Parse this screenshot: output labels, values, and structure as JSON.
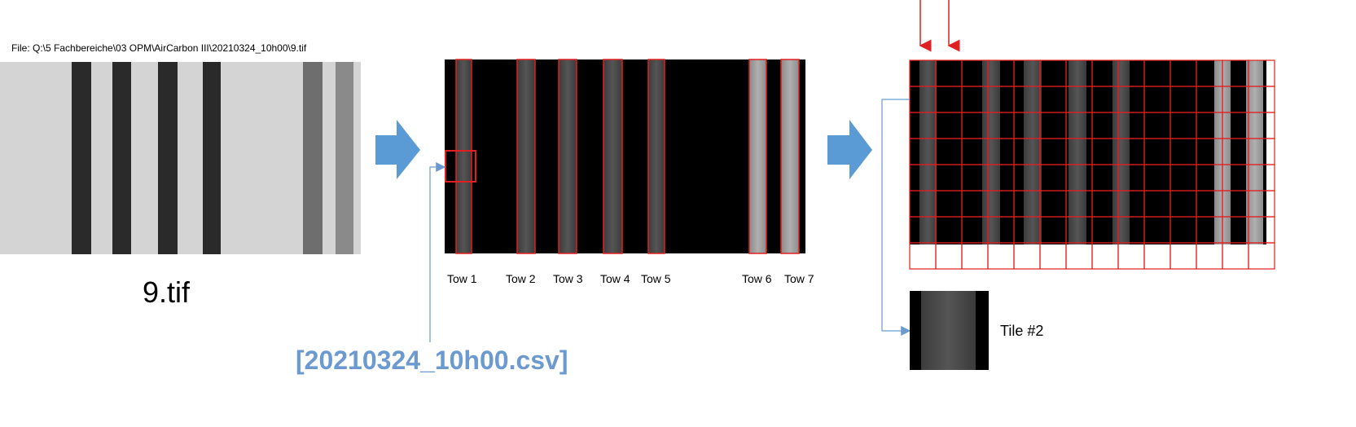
{
  "file_label": "File: Q:\\5 Fachbereiche\\03 OPM\\AirCarbon III\\20210324_10h00\\9.tif",
  "source_caption": "9.tif",
  "tows": [
    "Tow 1",
    "Tow 2",
    "Tow 3",
    "Tow 4",
    "Tow 5",
    "Tow 6",
    "Tow 7"
  ],
  "csv_label": "[20210324_10h00.csv]",
  "tile_label": "Tile #2",
  "colors": {
    "arrow_fill": "#5b9bd5",
    "box_red": "#e02020",
    "connector": "#6a9ad0",
    "csv_text": "#6a9ad0"
  }
}
